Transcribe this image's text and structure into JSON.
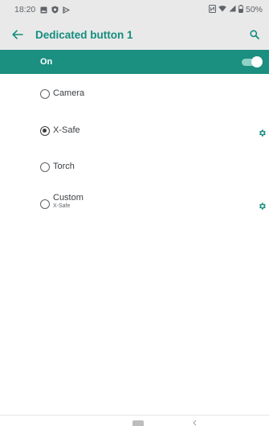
{
  "status_bar": {
    "time": "18:20",
    "battery": "50%",
    "left_icons": [
      "gallery-icon",
      "shield-icon",
      "play-icon"
    ],
    "right_icons": [
      "nfc-icon",
      "wifi-icon",
      "signal-icon",
      "battery-icon"
    ]
  },
  "app_bar": {
    "title": "Dedicated button 1",
    "back_icon": "arrow-back-icon",
    "search_icon": "search-icon"
  },
  "master_switch": {
    "label": "On",
    "state": true
  },
  "options": [
    {
      "label": "Camera",
      "selected": false,
      "settings_icon": false
    },
    {
      "label": "X-Safe",
      "selected": true,
      "settings_icon": true
    },
    {
      "label": "Torch",
      "selected": false,
      "settings_icon": false
    },
    {
      "label": "Custom",
      "sublabel": "X-Safe",
      "selected": false,
      "settings_icon": true
    }
  ],
  "colors": {
    "accent": "#1b8f80",
    "title": "#138d7f",
    "bar_background": "#e9e9e9"
  }
}
